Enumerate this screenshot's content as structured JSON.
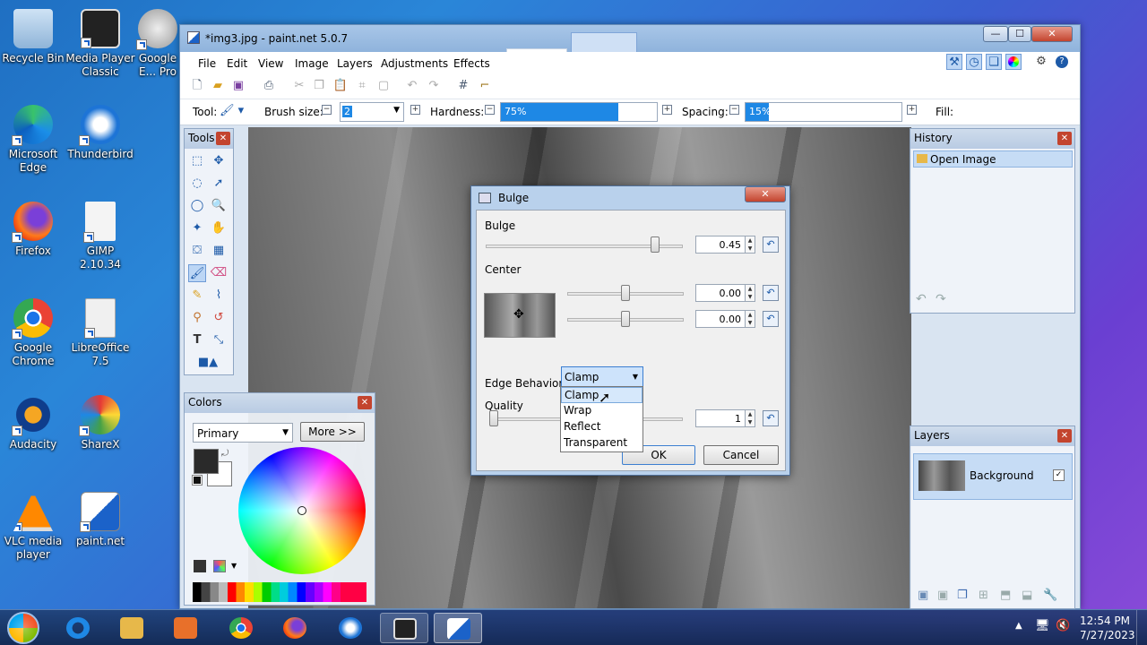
{
  "desktop": {
    "icons": [
      {
        "label": "Recycle Bin",
        "icon": "recycle-bin-icon"
      },
      {
        "label": "Media Player Classic",
        "icon": "media-player-icon"
      },
      {
        "label": "Google E... Pro",
        "icon": "google-earth-icon"
      },
      {
        "label": "Microsoft Edge",
        "icon": "edge-icon"
      },
      {
        "label": "Thunderbird",
        "icon": "thunderbird-icon"
      },
      {
        "label": "Firefox",
        "icon": "firefox-icon"
      },
      {
        "label": "GIMP 2.10.34",
        "icon": "gimp-icon"
      },
      {
        "label": "Google Chrome",
        "icon": "chrome-icon"
      },
      {
        "label": "LibreOffice 7.5",
        "icon": "libreoffice-icon"
      },
      {
        "label": "Audacity",
        "icon": "audacity-icon"
      },
      {
        "label": "ShareX",
        "icon": "sharex-icon"
      },
      {
        "label": "VLC media player",
        "icon": "vlc-icon"
      },
      {
        "label": "paint.net",
        "icon": "paintnet-icon"
      }
    ]
  },
  "window": {
    "title": "*img3.jpg - paint.net 5.0.7",
    "menus": [
      "File",
      "Edit",
      "View",
      "Image",
      "Layers",
      "Adjustments",
      "Effects"
    ]
  },
  "tooloptions": {
    "tool_label": "Tool:",
    "brush_size_label": "Brush size:",
    "brush_size_value": "2",
    "hardness_label": "Hardness:",
    "hardness_value": "75%",
    "hardness_fraction": 0.75,
    "spacing_label": "Spacing:",
    "spacing_value": "15%",
    "spacing_fraction": 0.15,
    "fill_label": "Fill:"
  },
  "panels": {
    "tools_title": "Tools",
    "colors_title": "Colors",
    "colors_mode": "Primary",
    "colors_more": "More >>",
    "history_title": "History",
    "history_items": [
      "Open Image"
    ],
    "layers_title": "Layers",
    "layers_items": [
      "Background"
    ]
  },
  "dialog": {
    "title": "Bulge",
    "bulge_label": "Bulge",
    "bulge_value": "0.45",
    "center_label": "Center",
    "center_x": "0.00",
    "center_y": "0.00",
    "edge_label": "Edge Behavior:",
    "edge_selected": "Clamp",
    "edge_options": [
      "Clamp",
      "Wrap",
      "Reflect",
      "Transparent"
    ],
    "quality_label": "Quality",
    "quality_value": "1",
    "ok": "OK",
    "cancel": "Cancel"
  },
  "taskbar": {
    "time": "12:54 PM",
    "date": "7/27/2023"
  },
  "colors": {
    "accent": "#1e88e5",
    "primary_color": "#2a2a2a",
    "secondary_color": "#ffffff"
  }
}
